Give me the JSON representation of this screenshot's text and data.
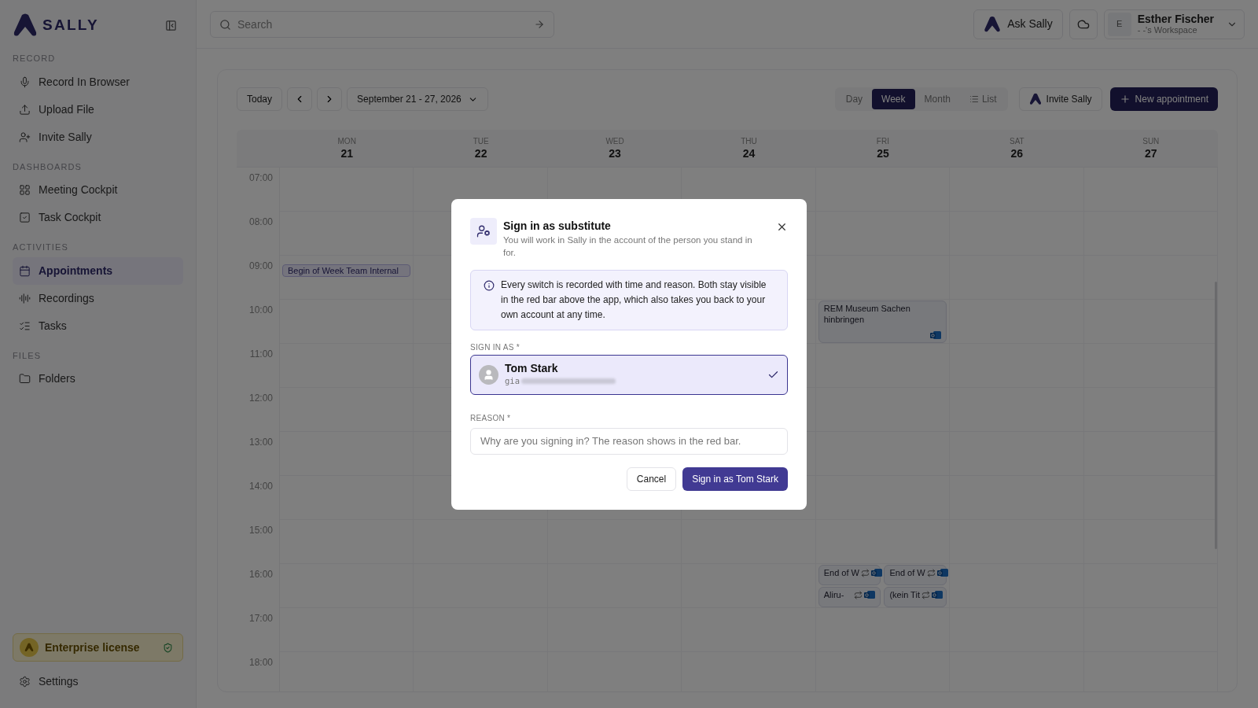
{
  "sidebar": {
    "brand": "SALLY",
    "sections": [
      {
        "heading": "RECORD",
        "items": [
          {
            "label": "Record In Browser",
            "kind": "mic",
            "selected": false
          },
          {
            "label": "Upload File",
            "kind": "upload",
            "selected": false
          },
          {
            "label": "Invite Sally",
            "kind": "invite",
            "selected": false
          }
        ]
      },
      {
        "heading": "DASHBOARDS",
        "items": [
          {
            "label": "Meeting Cockpit",
            "kind": "grid",
            "selected": false
          },
          {
            "label": "Task Cockpit",
            "kind": "task",
            "selected": false
          }
        ]
      },
      {
        "heading": "ACTIVITIES",
        "items": [
          {
            "label": "Appointments",
            "kind": "calendar",
            "selected": true
          },
          {
            "label": "Recordings",
            "kind": "audio",
            "selected": false
          },
          {
            "label": "Tasks",
            "kind": "checklist",
            "selected": false
          }
        ]
      },
      {
        "heading": "FILES",
        "items": [
          {
            "label": "Folders",
            "kind": "folder",
            "selected": false
          }
        ]
      }
    ],
    "license": "Enterprise license",
    "settings": "Settings"
  },
  "header": {
    "search": {
      "placeholder": "Search"
    },
    "ask": "Ask Sally",
    "user": {
      "initial": "E",
      "name": "Esther Fischer",
      "workspace": "- -'s Workspace"
    }
  },
  "calendar": {
    "today": "Today",
    "range": "September 21 - 27, 2026",
    "views": [
      {
        "label": "Day",
        "selected": false,
        "kind": "text"
      },
      {
        "label": "Week",
        "selected": true,
        "kind": "text"
      },
      {
        "label": "Month",
        "selected": false,
        "kind": "text"
      },
      {
        "label": "List",
        "selected": false,
        "kind": "list"
      }
    ],
    "invite": "Invite Sally",
    "new": "New appointment",
    "hours": [
      "07:00",
      "08:00",
      "09:00",
      "10:00",
      "11:00",
      "12:00",
      "13:00",
      "14:00",
      "15:00",
      "16:00",
      "17:00",
      "18:00"
    ],
    "days": [
      {
        "weekday": "MON",
        "date": "21",
        "events": [
          {
            "title": "Begin of Week Team Internal",
            "kind": "pill",
            "recurring": false,
            "synced": false
          }
        ]
      },
      {
        "weekday": "TUE",
        "date": "22"
      },
      {
        "weekday": "WED",
        "date": "23"
      },
      {
        "weekday": "THU",
        "date": "24"
      },
      {
        "weekday": "FRI",
        "date": "25",
        "events": [
          {
            "title": "REM Museum Sachen hinbringen",
            "kind": "card",
            "recurring": false,
            "synced": true
          },
          {
            "title": "End of W",
            "kind": "card",
            "recurring": true,
            "synced": true
          },
          {
            "title": "End of W",
            "kind": "card",
            "recurring": true,
            "synced": true
          },
          {
            "title": "Aliru-",
            "kind": "card",
            "recurring": true,
            "synced": true
          },
          {
            "title": "(kein Tit",
            "kind": "card",
            "recurring": true,
            "synced": true
          }
        ]
      },
      {
        "weekday": "SAT",
        "date": "26"
      },
      {
        "weekday": "SUN",
        "date": "27"
      }
    ]
  },
  "dialog": {
    "title": "Sign in as substitute",
    "subtitle": "You will work in Sally in the account of the person you stand in for.",
    "notice": "Every switch is recorded with time and reason. Both stay visible in the red bar above the app, which also takes you back to your own account at any time.",
    "sign_in_label": "SIGN IN AS *",
    "person": {
      "name": "Tom Stark",
      "email": "gia",
      "selected": true
    },
    "reason_label": "REASON *",
    "reason": {
      "placeholder": "Why are you signing in? The reason shows in the red bar."
    },
    "cancel": "Cancel",
    "confirm": "Sign in as Tom Stark"
  }
}
